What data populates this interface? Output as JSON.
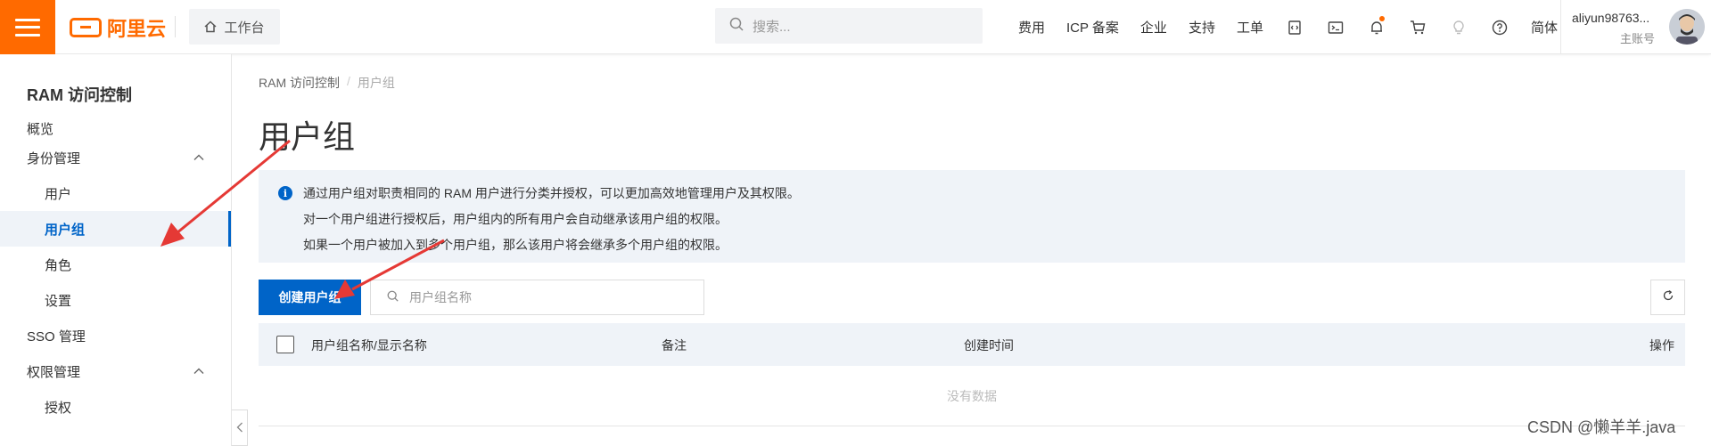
{
  "topbar": {
    "logo_text": "阿里云",
    "workbench_label": "工作台",
    "search_placeholder": "搜索...",
    "nav": [
      "费用",
      "ICP 备案",
      "企业",
      "支持",
      "工单"
    ],
    "lang": "简体",
    "user_name": "aliyun98763...",
    "user_role": "主账号",
    "brand_color": "#ff6a00"
  },
  "sidebar": {
    "title": "RAM 访问控制",
    "items": [
      {
        "label": "概览",
        "level": 1
      },
      {
        "label": "身份管理",
        "level": 1,
        "expanded": true
      },
      {
        "label": "用户",
        "level": 2
      },
      {
        "label": "用户组",
        "level": 2,
        "active": true
      },
      {
        "label": "角色",
        "level": 2
      },
      {
        "label": "设置",
        "level": 2
      },
      {
        "label": "SSO 管理",
        "level": 1
      },
      {
        "label": "权限管理",
        "level": 1,
        "expanded": true
      },
      {
        "label": "授权",
        "level": 2
      }
    ],
    "accent_color": "#0064c8"
  },
  "main": {
    "breadcrumb": [
      "RAM 访问控制",
      "用户组"
    ],
    "title": "用户组",
    "notice": [
      "通过用户组对职责相同的 RAM 用户进行分类并授权，可以更加高效地管理用户及其权限。",
      "对一个用户组进行授权后，用户组内的所有用户会自动继承该用户组的权限。",
      "如果一个用户被加入到多个用户组，那么该用户将会继承多个用户组的权限。"
    ],
    "create_button": "创建用户组",
    "filter_placeholder": "用户组名称",
    "table": {
      "columns": [
        "用户组名称/显示名称",
        "备注",
        "创建时间",
        "操作"
      ],
      "empty_text": "没有数据"
    }
  },
  "watermark": "CSDN @懒羊羊.java",
  "annotation_color": "#e53935"
}
